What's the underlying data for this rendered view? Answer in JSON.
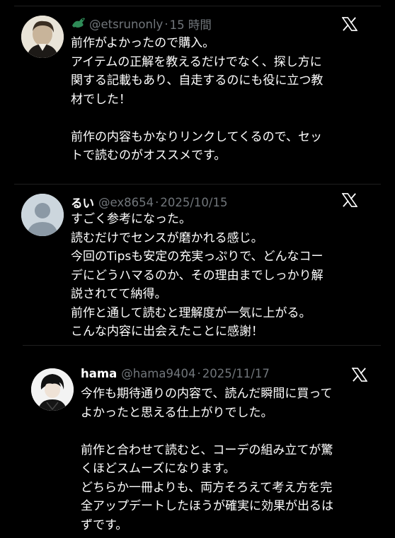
{
  "tweets": [
    {
      "name": "",
      "handle": "@etsrunonly",
      "sep": "·",
      "time": "15 時間",
      "lines": [
        "前作がよかったので購入。",
        "アイテムの正解を教えるだけでなく、探し方に",
        "関する記載もあり、自走するのにも役に立つ教",
        "材でした！",
        "",
        "前作の内容もかなりリンクしてくるので、セッ",
        "トで読むのがオススメです。"
      ]
    },
    {
      "name": "るい",
      "handle": "@ex8654",
      "sep": "·",
      "time": "2025/10/15",
      "lines": [
        "すごく参考になった。",
        "読むだけでセンスが磨かれる感じ。",
        "今回のTipsも安定の充実っぷりで、どんなコー",
        "デにどうハマるのか、その理由までしっかり解",
        "説されてて納得。",
        "前作と通して読むと理解度が一気に上がる。",
        "こんな内容に出会えたことに感謝！"
      ]
    },
    {
      "name": "hama",
      "handle": "@hama9404",
      "sep": "·",
      "time": "2025/11/17",
      "lines": [
        "今作も期待通りの内容で、読んだ瞬間に買って",
        "よかったと思える仕上がりでした。",
        "",
        "前作と合わせて読むと、コーデの組み立てが驚",
        "くほどスムーズになります。",
        "どちらか一冊よりも、両方そろえて考え方を完",
        "全アップデートしたほうが確実に効果が出るは",
        "ずです。"
      ]
    }
  ],
  "colors": {
    "background": "#000000",
    "text": "#ffffff",
    "meta": "#71767b",
    "badge_green": "#2e8b57"
  }
}
